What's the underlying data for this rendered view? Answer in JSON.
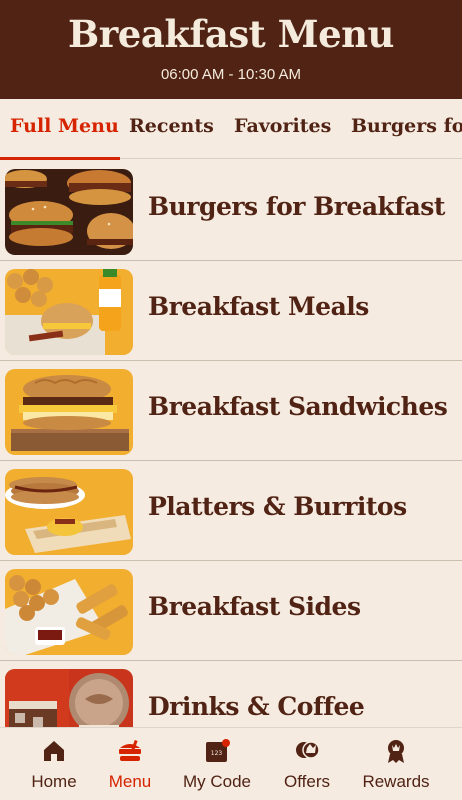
{
  "header": {
    "title": "Breakfast Menu",
    "hours": "06:00 AM - 10:30 AM"
  },
  "tabs": [
    {
      "label": "Full Menu",
      "active": true
    },
    {
      "label": "Recents",
      "active": false
    },
    {
      "label": "Favorites",
      "active": false
    },
    {
      "label": "Burgers fo",
      "active": false
    }
  ],
  "categories": [
    {
      "label": "Burgers for Breakfast",
      "icon": "burgers-image"
    },
    {
      "label": "Breakfast Meals",
      "icon": "meal-image"
    },
    {
      "label": "Breakfast Sandwiches",
      "icon": "sandwich-image"
    },
    {
      "label": "Platters & Burritos",
      "icon": "platter-image"
    },
    {
      "label": "Breakfast Sides",
      "icon": "sides-image"
    },
    {
      "label": "Drinks & Coffee",
      "icon": "drinks-image"
    }
  ],
  "nav": [
    {
      "label": "Home",
      "icon": "home-icon",
      "active": false
    },
    {
      "label": "Menu",
      "icon": "menu-icon",
      "active": true
    },
    {
      "label": "My Code",
      "icon": "code-icon",
      "active": false,
      "badge_text": "123"
    },
    {
      "label": "Offers",
      "icon": "offers-icon",
      "active": false
    },
    {
      "label": "Rewards",
      "icon": "rewards-icon",
      "active": false
    }
  ],
  "colors": {
    "brand_brown": "#502314",
    "accent_red": "#d62300",
    "background": "#f5ebe0"
  }
}
